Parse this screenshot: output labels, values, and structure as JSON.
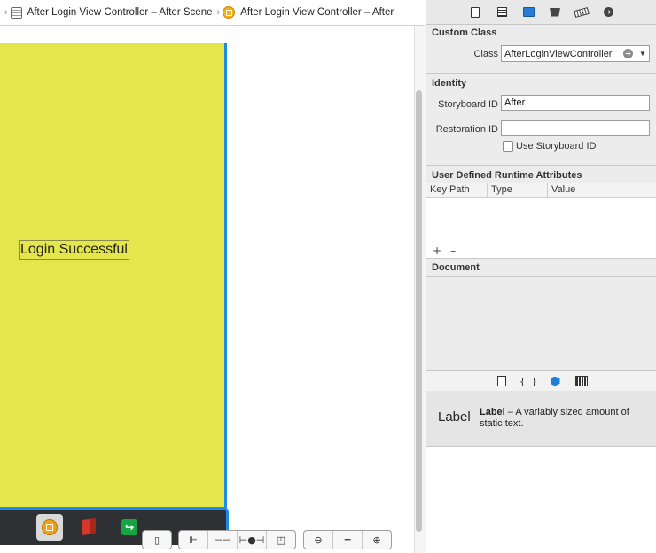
{
  "breadcrumb": {
    "items": [
      "After Login View Controller – After Scene",
      "After Login View Controller – After"
    ]
  },
  "canvas": {
    "label_text": "Login Successful",
    "scene_bg": "#e4e64b",
    "selection_color": "#1b8bee"
  },
  "canvas_toolbar": {
    "icons": [
      "device-icon",
      "align-icon",
      "pin-icon",
      "resolve-icon",
      "resize-icon",
      "zoom-out-icon",
      "zoom-reset-icon",
      "zoom-in-icon"
    ]
  },
  "inspector": {
    "tabs": [
      "file-inspector-icon",
      "quick-help-icon",
      "identity-inspector-icon",
      "attributes-inspector-icon",
      "size-inspector-icon",
      "connections-inspector-icon"
    ],
    "custom_class": {
      "title": "Custom Class",
      "class_label": "Class",
      "class_value": "AfterLoginViewController"
    },
    "identity": {
      "title": "Identity",
      "storyboard_id_label": "Storyboard ID",
      "storyboard_id_value": "After",
      "restoration_id_label": "Restoration ID",
      "restoration_id_value": "",
      "use_storyboard_id_label": "Use Storyboard ID"
    },
    "runtime_attributes": {
      "title": "User Defined Runtime Attributes",
      "columns": [
        "Key Path",
        "Type",
        "Value"
      ],
      "add": "+",
      "remove": "–"
    },
    "document": {
      "title": "Document"
    },
    "library": {
      "tabs": [
        "file-template-icon",
        "{ }",
        "object-library-icon",
        "media-library-icon"
      ],
      "item_name": "Label",
      "item_title": "Label",
      "item_desc": " – A variably sized amount of static text."
    }
  }
}
